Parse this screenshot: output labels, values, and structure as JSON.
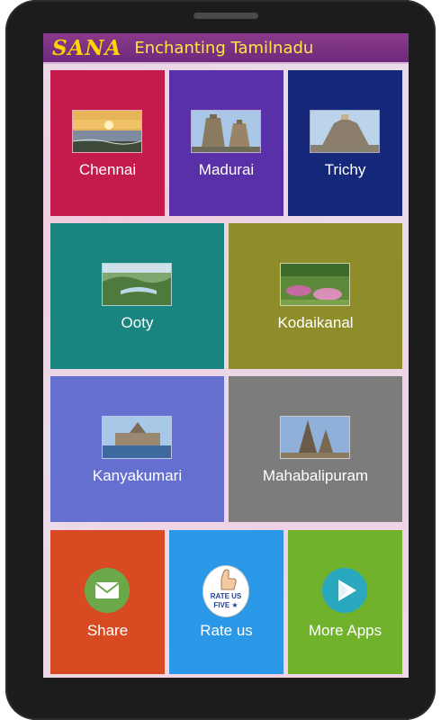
{
  "header": {
    "brand": "SANA",
    "title": "Enchanting Tamilnadu"
  },
  "tiles": [
    {
      "label": "Chennai",
      "color": "#c41a4c"
    },
    {
      "label": "Madurai",
      "color": "#5930a8"
    },
    {
      "label": "Trichy",
      "color": "#16287a"
    },
    {
      "label": "Ooty",
      "color": "#1a8480"
    },
    {
      "label": "Kodaikanal",
      "color": "#8f8d2a"
    },
    {
      "label": "Kanyakumari",
      "color": "#656fd0"
    },
    {
      "label": "Mahabalipuram",
      "color": "#7c7c7c"
    }
  ],
  "actions": {
    "share": {
      "label": "Share",
      "color": "#d84a21"
    },
    "rate": {
      "label": "Rate us",
      "color": "#2a98e6",
      "badge_line1": "RATE US",
      "badge_line2": "FIVE ★"
    },
    "more": {
      "label": "More Apps",
      "color": "#71b22c"
    }
  }
}
